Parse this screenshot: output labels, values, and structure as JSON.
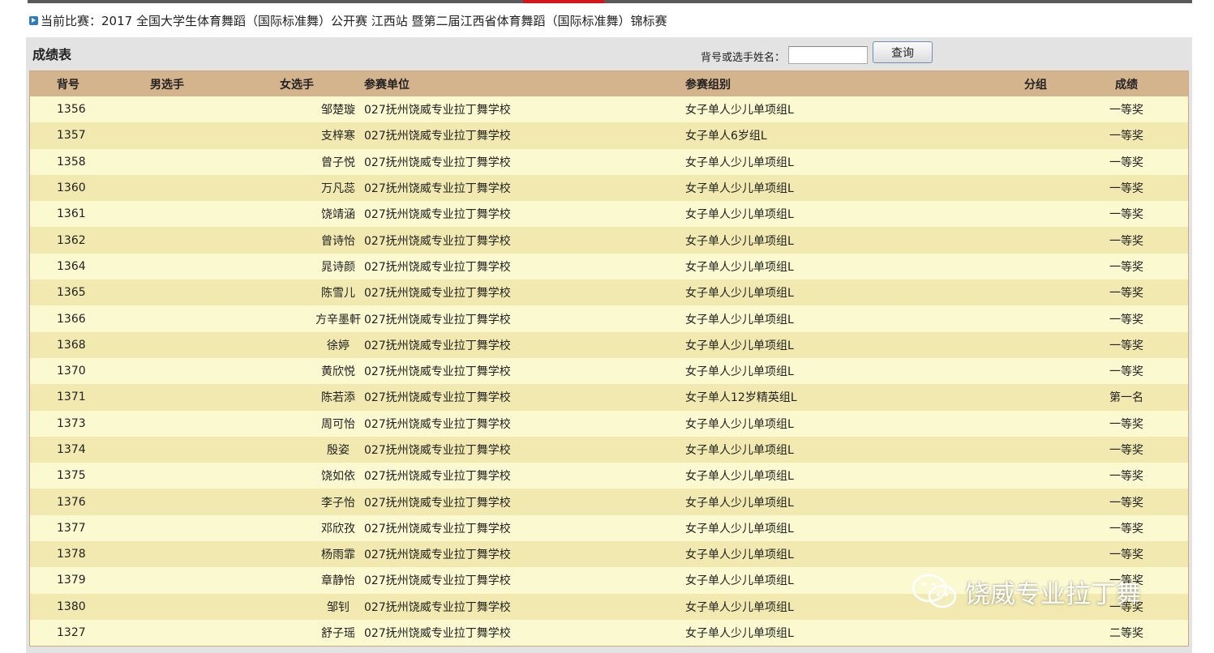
{
  "match": {
    "label": "当前比赛：",
    "name": "2017 全国大学生体育舞蹈（国际标准舞）公开赛  江西站  暨第二届江西省体育舞蹈（国际标准舞）锦标赛"
  },
  "panel": {
    "title": "成绩表",
    "search_label": "背号或选手姓名：",
    "search_value": "",
    "search_button": "查询"
  },
  "table": {
    "headers": {
      "number": "背号",
      "male": "男选手",
      "female": "女选手",
      "unit": "参赛单位",
      "group": "参赛组别",
      "subgroup": "分组",
      "result": "成绩"
    },
    "rows": [
      {
        "number": "1356",
        "male": "",
        "female": "邹楚璇",
        "unit": "027抚州饶威专业拉丁舞学校",
        "group": "女子单人少儿单项组L",
        "subgroup": "",
        "result": "一等奖"
      },
      {
        "number": "1357",
        "male": "",
        "female": "支梓寒",
        "unit": "027抚州饶威专业拉丁舞学校",
        "group": "女子单人6岁组L",
        "subgroup": "",
        "result": "一等奖"
      },
      {
        "number": "1358",
        "male": "",
        "female": "曾子悦",
        "unit": "027抚州饶威专业拉丁舞学校",
        "group": "女子单人少儿单项组L",
        "subgroup": "",
        "result": "一等奖"
      },
      {
        "number": "1360",
        "male": "",
        "female": "万凡蕊",
        "unit": "027抚州饶威专业拉丁舞学校",
        "group": "女子单人少儿单项组L",
        "subgroup": "",
        "result": "一等奖"
      },
      {
        "number": "1361",
        "male": "",
        "female": "饶靖涵",
        "unit": "027抚州饶威专业拉丁舞学校",
        "group": "女子单人少儿单项组L",
        "subgroup": "",
        "result": "一等奖"
      },
      {
        "number": "1362",
        "male": "",
        "female": "曾诗怡",
        "unit": "027抚州饶威专业拉丁舞学校",
        "group": "女子单人少儿单项组L",
        "subgroup": "",
        "result": "一等奖"
      },
      {
        "number": "1364",
        "male": "",
        "female": "晁诗颜",
        "unit": "027抚州饶威专业拉丁舞学校",
        "group": "女子单人少儿单项组L",
        "subgroup": "",
        "result": "一等奖"
      },
      {
        "number": "1365",
        "male": "",
        "female": "陈雪儿",
        "unit": "027抚州饶威专业拉丁舞学校",
        "group": "女子单人少儿单项组L",
        "subgroup": "",
        "result": "一等奖"
      },
      {
        "number": "1366",
        "male": "",
        "female": "方辛墨軒",
        "unit": "027抚州饶威专业拉丁舞学校",
        "group": "女子单人少儿单项组L",
        "subgroup": "",
        "result": "一等奖"
      },
      {
        "number": "1368",
        "male": "",
        "female": "徐婷",
        "unit": "027抚州饶威专业拉丁舞学校",
        "group": "女子单人少儿单项组L",
        "subgroup": "",
        "result": "一等奖"
      },
      {
        "number": "1370",
        "male": "",
        "female": "黄欣悦",
        "unit": "027抚州饶威专业拉丁舞学校",
        "group": "女子单人少儿单项组L",
        "subgroup": "",
        "result": "一等奖"
      },
      {
        "number": "1371",
        "male": "",
        "female": "陈若添",
        "unit": "027抚州饶威专业拉丁舞学校",
        "group": "女子单人12岁精英组L",
        "subgroup": "",
        "result": "第一名"
      },
      {
        "number": "1373",
        "male": "",
        "female": "周可怡",
        "unit": "027抚州饶威专业拉丁舞学校",
        "group": "女子单人少儿单项组L",
        "subgroup": "",
        "result": "一等奖"
      },
      {
        "number": "1374",
        "male": "",
        "female": "殷姿",
        "unit": "027抚州饶威专业拉丁舞学校",
        "group": "女子单人少儿单项组L",
        "subgroup": "",
        "result": "一等奖"
      },
      {
        "number": "1375",
        "male": "",
        "female": "饶如依",
        "unit": "027抚州饶威专业拉丁舞学校",
        "group": "女子单人少儿单项组L",
        "subgroup": "",
        "result": "一等奖"
      },
      {
        "number": "1376",
        "male": "",
        "female": "李子怡",
        "unit": "027抚州饶威专业拉丁舞学校",
        "group": "女子单人少儿单项组L",
        "subgroup": "",
        "result": "一等奖"
      },
      {
        "number": "1377",
        "male": "",
        "female": "邓欣孜",
        "unit": "027抚州饶威专业拉丁舞学校",
        "group": "女子单人少儿单项组L",
        "subgroup": "",
        "result": "一等奖"
      },
      {
        "number": "1378",
        "male": "",
        "female": "杨雨霏",
        "unit": "027抚州饶威专业拉丁舞学校",
        "group": "女子单人少儿单项组L",
        "subgroup": "",
        "result": "一等奖"
      },
      {
        "number": "1379",
        "male": "",
        "female": "章静怡",
        "unit": "027抚州饶威专业拉丁舞学校",
        "group": "女子单人少儿单项组L",
        "subgroup": "",
        "result": "一等奖"
      },
      {
        "number": "1380",
        "male": "",
        "female": "邹钊",
        "unit": "027抚州饶威专业拉丁舞学校",
        "group": "女子单人少儿单项组L",
        "subgroup": "",
        "result": "一等奖"
      },
      {
        "number": "1327",
        "male": "",
        "female": "舒子瑶",
        "unit": "027抚州饶威专业拉丁舞学校",
        "group": "女子单人少儿单项组L",
        "subgroup": "",
        "result": "二等奖"
      }
    ]
  },
  "watermark": {
    "text": "饶威专业拉丁舞",
    "icon": "wechat-icon"
  },
  "colors": {
    "header_bg": "#d3b48c",
    "row_odd": "#fbf9cf",
    "row_even": "#f1e9af",
    "accent": "#d8141b"
  }
}
